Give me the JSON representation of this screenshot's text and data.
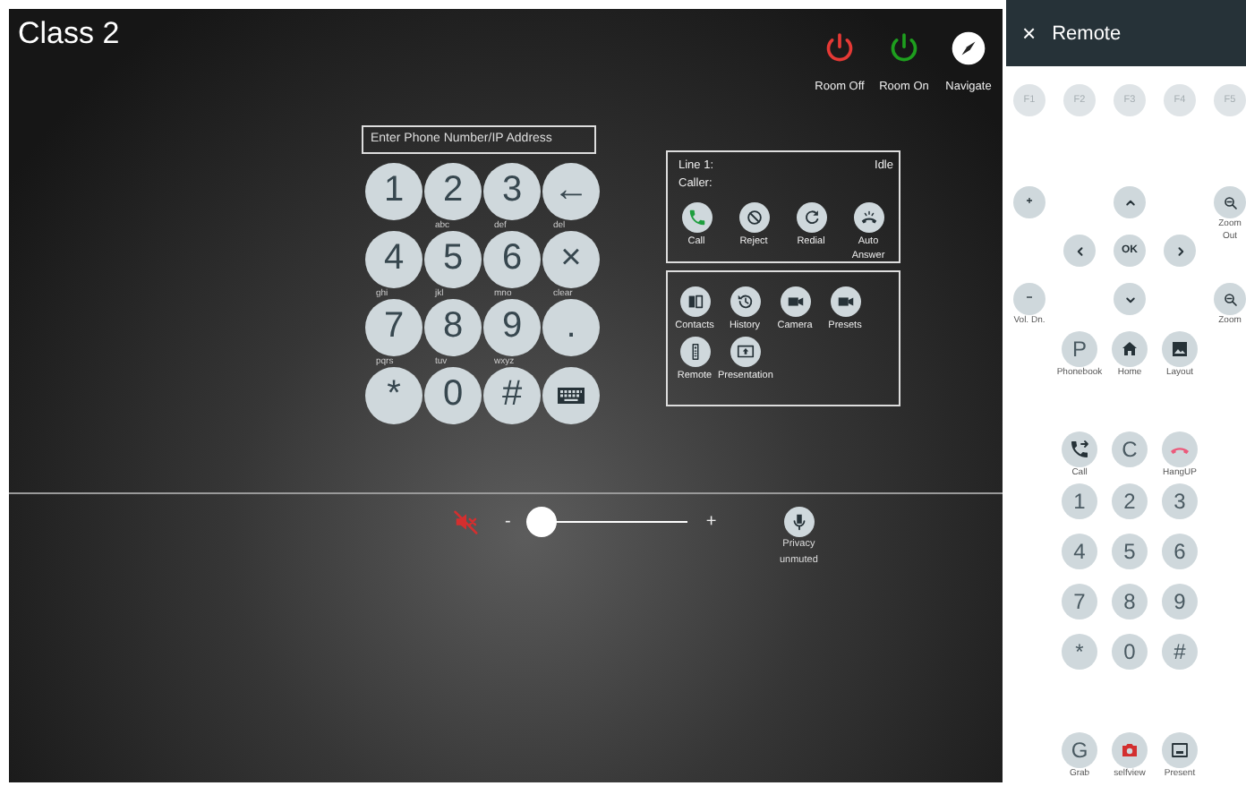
{
  "title": "Class 2",
  "room_controls": [
    {
      "label": "Room Off",
      "kind": "power",
      "color": "#e53935"
    },
    {
      "label": "Room On",
      "kind": "power",
      "color": "#1e9e1e"
    },
    {
      "label": "Navigate",
      "kind": "compass"
    }
  ],
  "dial_field": {
    "placeholder": "Enter Phone Number/IP Address"
  },
  "keypad": [
    {
      "kind": "text",
      "key": "1"
    },
    {
      "kind": "text",
      "key": "2",
      "letters": "abc"
    },
    {
      "kind": "text",
      "key": "3",
      "letters": "def"
    },
    {
      "kind": "text",
      "key": "←",
      "letters": "del"
    },
    {
      "kind": "text",
      "key": "4",
      "letters": "ghi"
    },
    {
      "kind": "text",
      "key": "5",
      "letters": "jkl"
    },
    {
      "kind": "text",
      "key": "6",
      "letters": "mno"
    },
    {
      "kind": "text",
      "key": "×",
      "letters": "clear"
    },
    {
      "kind": "text",
      "key": "7",
      "letters": "pqrs"
    },
    {
      "kind": "text",
      "key": "8",
      "letters": "tuv"
    },
    {
      "kind": "text",
      "key": "9",
      "letters": "wxyz"
    },
    {
      "kind": "text",
      "key": "."
    },
    {
      "kind": "text",
      "key": "*"
    },
    {
      "kind": "text",
      "key": "0"
    },
    {
      "kind": "text",
      "key": "#"
    },
    {
      "kind": "keyboard"
    }
  ],
  "line_status": {
    "line": "Line 1:",
    "state": "Idle",
    "caller": "Caller:",
    "actions": [
      {
        "label": "Call",
        "kind": "call"
      },
      {
        "label": "Reject",
        "kind": "reject"
      },
      {
        "label": "Redial",
        "kind": "redial"
      },
      {
        "label": "Auto Answer",
        "kind": "auto-answer"
      }
    ]
  },
  "features": [
    {
      "label": "Contacts",
      "kind": "contacts"
    },
    {
      "label": "History",
      "kind": "history"
    },
    {
      "label": "Camera",
      "kind": "video"
    },
    {
      "label": "Presets",
      "kind": "video"
    },
    {
      "label": "Remote",
      "kind": "remote"
    },
    {
      "label": "Presentation",
      "kind": "presentation"
    }
  ],
  "audio": {
    "muted": true,
    "minus": "-",
    "level": 0.1,
    "plus": "+",
    "privacy": {
      "label": "Privacy unmuted",
      "kind": "mic"
    }
  },
  "remote": {
    "close": "×",
    "title": "Remote",
    "function_keys": [
      "F1",
      "F2",
      "F3",
      "F4",
      "F5"
    ],
    "nav": [
      {
        "kind": "text",
        "text": "+"
      },
      {
        "kind": "up"
      },
      {
        "kind": "zoom",
        "label": "Zoom Out"
      },
      {
        "kind": "left"
      },
      {
        "kind": "text",
        "text": "OK"
      },
      {
        "kind": "right"
      },
      {
        "kind": "text",
        "text": "−",
        "label": "Vol. Dn."
      },
      {
        "kind": "down"
      },
      {
        "kind": "zoom",
        "label": "Zoom"
      }
    ],
    "menu": [
      {
        "kind": "text",
        "text": "P",
        "label": "Phonebook"
      },
      {
        "kind": "home",
        "label": "Home"
      },
      {
        "kind": "image",
        "label": "Layout"
      }
    ],
    "call_row": [
      {
        "kind": "call-transfer",
        "label": "Call"
      },
      {
        "kind": "text",
        "text": "C"
      },
      {
        "kind": "hangup",
        "label": "HangUP"
      }
    ],
    "dial": [
      {
        "kind": "text",
        "text": "1"
      },
      {
        "kind": "text",
        "text": "2"
      },
      {
        "kind": "text",
        "text": "3"
      },
      {
        "kind": "text",
        "text": "4"
      },
      {
        "kind": "text",
        "text": "5"
      },
      {
        "kind": "text",
        "text": "6"
      },
      {
        "kind": "text",
        "text": "7"
      },
      {
        "kind": "text",
        "text": "8"
      },
      {
        "kind": "text",
        "text": "9"
      },
      {
        "kind": "text",
        "text": "*"
      },
      {
        "kind": "text",
        "text": "0"
      },
      {
        "kind": "text",
        "text": "#"
      }
    ],
    "bottom": [
      {
        "kind": "text",
        "text": "G",
        "label": "Grab"
      },
      {
        "kind": "camera",
        "label": "selfview"
      },
      {
        "kind": "present",
        "label": "Present"
      }
    ]
  }
}
